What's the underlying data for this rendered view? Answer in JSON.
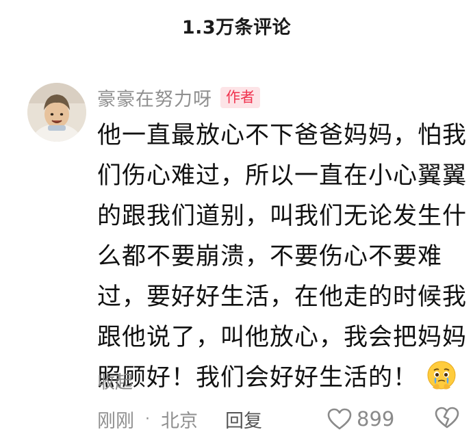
{
  "header": {
    "title": "1.3万条评论"
  },
  "comment": {
    "author_name": "豪豪在努力呀",
    "author_badge": "作者",
    "body_lines": [
      "他一直最放心不下爸爸妈妈，怕我",
      "们伤心难过，所以一直在小心翼翼",
      "的跟我们道别，叫我们无论发生什",
      "么都不要崩溃，不要伤心不要难",
      "过，要好好生活，在他走的时候我",
      "跟他说了，叫他放心，我会把妈妈",
      "照顾好！我们会好好生活的！"
    ],
    "emoji": "crying-face-emoji",
    "collapse_label": "收起",
    "time": "刚刚",
    "separator": "·",
    "location": "北京",
    "reply_label": "回复",
    "like_count": "899",
    "icons": {
      "like": "heart-outline-icon",
      "dislike": "broken-heart-icon"
    },
    "colors": {
      "badge_bg": "#fde4e7",
      "badge_text": "#f0334f",
      "meta_gray": "#8f8f8f"
    }
  }
}
